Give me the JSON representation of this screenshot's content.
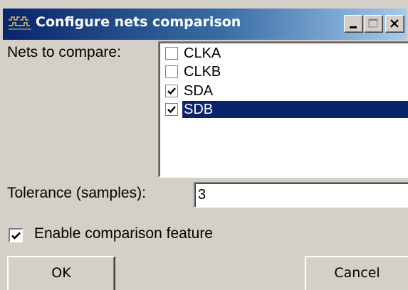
{
  "window": {
    "title": "Configure nets comparison",
    "title_icon": "waveform-icon",
    "controls": [
      "minimize",
      "maximize",
      "close"
    ]
  },
  "nets": {
    "label": "Nets to compare:",
    "items": [
      {
        "label": "CLKA",
        "checked": false,
        "selected": false
      },
      {
        "label": "CLKB",
        "checked": false,
        "selected": false
      },
      {
        "label": "SDA",
        "checked": true,
        "selected": false
      },
      {
        "label": "SDB",
        "checked": true,
        "selected": true
      }
    ]
  },
  "tolerance": {
    "label": "Tolerance (samples):",
    "value": "3"
  },
  "enable": {
    "label": "Enable comparison feature",
    "checked": true
  },
  "buttons": {
    "ok": "OK",
    "cancel": "Cancel"
  },
  "colors": {
    "face": "#d4d0c8",
    "title_start": "#0a246a",
    "title_end": "#a6caf0",
    "selection": "#0a246a"
  }
}
